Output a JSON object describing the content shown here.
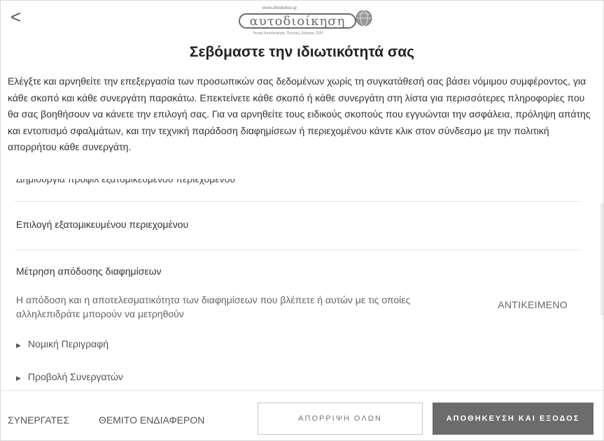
{
  "header": {
    "back_icon": "chevron-left-icon",
    "back_glyph": "<",
    "logo": {
      "url_text": "www.aftodioikisi.gr",
      "wordmark": "αυτοδιοίκηση",
      "tagline": "Τοπική Αυτοδιοίκηση, Πολιτική, Ειδήσεις 2020",
      "icon": "globe-icon"
    },
    "title": "Σεβόμαστε την ιδιωτικότητά σας"
  },
  "intro_text": "Ελέγξτε και αρνηθείτε την επεξεργασία των προσωπικών σας δεδομένων χωρίς τη συγκατάθεσή σας βάσει νόμιμου συμφέροντος, για κάθε σκοπό και κάθε συνεργάτη παρακάτω. Επεκτείνετε κάθε σκοπό ή κάθε συνεργάτη στη λίστα για περισσότερες πληροφορίες που θα σας βοηθήσουν να κάνετε την επιλογή σας. Για να αρνηθείτε τους ειδικούς σκοπούς που εγγυώνται την ασφάλεια, πρόληψη απάτης και εντοπισμό σφαλμάτων, και την τεχνική παράδοση διαφημίσεων ή περιεχομένου κάντε κλικ στον σύνδεσμο με την πολιτική απορρήτου κάθε συνεργάτη.",
  "purposes": {
    "cut_off_item": "Δημιουργία προφίλ εξατομικευμένου περιεχομένου",
    "item_personalised_content": "Επιλογή εξατομικευμένου περιεχομένου",
    "item_ad_measurement": {
      "label": "Μέτρηση απόδοσης διαφημίσεων",
      "description": "Η απόδοση και η αποτελεσματικότητα των διαφημίσεων που βλέπετε ή αυτών με τις οποίες αλληλεπιδράτε μπορούν να μετρηθούν",
      "object_label": "ΑΝΤΙΚΕΙΜΕΝΟ",
      "legal_description": "Νομική Περιγραφή",
      "view_partners": "Προβολή Συνεργατών",
      "expander_icon": "triangle-right-icon"
    }
  },
  "footer": {
    "partners_link": "ΣΥΝΕΡΓΑΤΕΣ",
    "legitimate_interest_link": "ΘΕΜΙΤΟ ΕΝΔΙΑΦΕΡΟΝ",
    "reject_all_button": "ΑΠΟΡΡΙΨΗ ΟΛΩΝ",
    "save_exit_button": "ΑΠΟΘΗΚΕΥΣΗ ΚΑΙ ΕΞΟΔΟΣ"
  }
}
